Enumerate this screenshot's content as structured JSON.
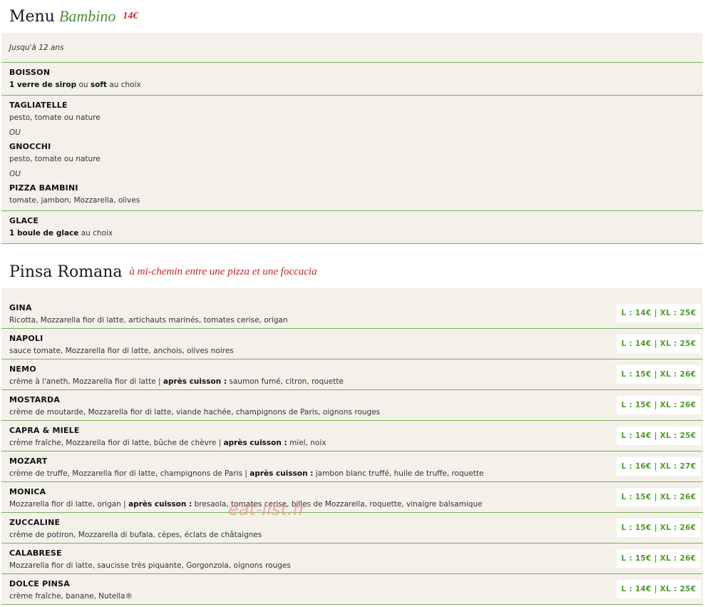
{
  "bambino": {
    "title": "Menu",
    "title_em": "Bambino",
    "price": "14€",
    "note": "Jusqu'à 12 ans",
    "boisson": {
      "title": "BOISSON",
      "desc_b1": "1 verre de sirop",
      "desc_t1": " ou ",
      "desc_b2": "soft",
      "desc_t2": " au choix"
    },
    "tagliatelle": {
      "title": "TAGLIATELLE",
      "desc": "pesto, tomate ou nature"
    },
    "ou1": "OU",
    "gnocchi": {
      "title": "GNOCCHI",
      "desc": "pesto, tomate ou nature"
    },
    "ou2": "OU",
    "pizza": {
      "title": "PIZZA BAMBINI",
      "desc": "tomate, jambon, Mozzarella, olives"
    },
    "glace": {
      "title": "GLACE",
      "desc_b1": "1 boule de glace",
      "desc_t1": " au choix"
    }
  },
  "pinsa": {
    "title": "Pinsa Romana",
    "tagline": "à mi-chemin entre une pizza et une foccacia",
    "items": [
      {
        "name": "GINA",
        "desc": "Ricotta, Mozzarella fior di latte, artichauts marinés, tomates cerise, origan",
        "after_label": "",
        "after": "",
        "price": "L : 14€ | XL : 25€"
      },
      {
        "name": "NAPOLI",
        "desc": "sauce tomate, Mozzarella fior di latte, anchois, olives noires",
        "after_label": "",
        "after": "",
        "price": "L : 14€ | XL : 25€"
      },
      {
        "name": "NEMO",
        "desc": "crème à l'aneth, Mozzarella fior di latte | ",
        "after_label": "après cuisson :",
        "after": " saumon fumé, citron, roquette",
        "price": "L : 15€ | XL : 26€"
      },
      {
        "name": "MOSTARDA",
        "desc": "crème de moutarde, Mozzarella fior di latte, viande hachée, champignons de Paris, oignons rouges",
        "after_label": "",
        "after": "",
        "price": "L : 15€ | XL : 26€"
      },
      {
        "name": "CAPRA & MIELE",
        "desc": "crème fraîche, Mozzarella fior di latte, bûche de chèvre | ",
        "after_label": "après cuisson :",
        "after": " miel, noix",
        "price": "L : 14€ | XL : 25€"
      },
      {
        "name": "MOZART",
        "desc": "crème de truffe, Mozzarella fior di latte, champignons de Paris | ",
        "after_label": "après cuisson :",
        "after": " jambon blanc truffé, huile de truffe, roquette",
        "price": "L : 16€ | XL : 27€"
      },
      {
        "name": "MONICA",
        "desc": "Mozzarella fior di latte, origan | ",
        "after_label": "après cuisson :",
        "after": " bresaola, tomates cerise, billes de Mozzarella, roquette, vinaigre balsamique",
        "price": "L : 15€ | XL : 26€"
      },
      {
        "name": "ZUCCALINE",
        "desc": "crème de potiron, Mozzarella di bufala, cèpes, éclats de châtaignes",
        "after_label": "",
        "after": "",
        "price": "L : 15€ | XL : 26€"
      },
      {
        "name": "CALABRESE",
        "desc": "Mozzarella fior di latte, saucisse très piquante, Gorgonzola, oignons rouges",
        "after_label": "",
        "after": "",
        "price": "L : 15€ | XL : 26€"
      },
      {
        "name": "DOLCE PINSA",
        "desc": "crème fraîche, banane, Nutella®",
        "after_label": "",
        "after": "",
        "price": "L : 14€ | XL : 25€"
      }
    ]
  },
  "watermark": "eat-list.fr"
}
